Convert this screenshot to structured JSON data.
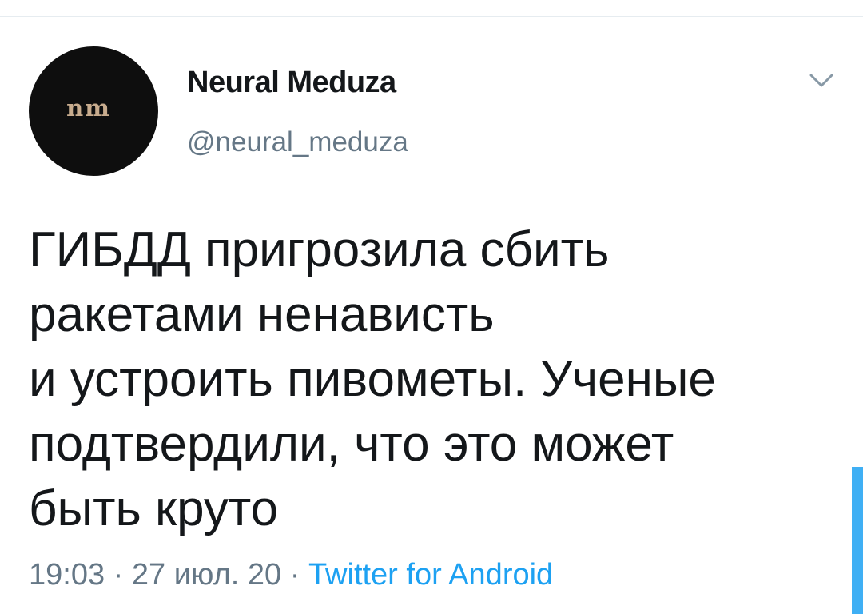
{
  "tweet": {
    "author": {
      "display_name": "Neural Meduza",
      "handle": "@neural_meduza",
      "avatar_logo": "nm",
      "avatar_bg": "#0e0e0e",
      "avatar_logo_color": "#c8ac8e"
    },
    "menu_icon": "chevron-down-icon",
    "text_lines": [
      "ГИБДД пригрозила сбить",
      "ракетами ненависть",
      "и устроить пивометы. Ученые",
      "подтвердили, что это может",
      "быть круто"
    ],
    "time": "19:03",
    "date": "27 июл. 20",
    "separator": "·",
    "source": "Twitter for Android"
  },
  "colors": {
    "text": "#14171a",
    "secondary": "#657786",
    "accent": "#1da1f2",
    "divider": "#e6ecf0"
  }
}
